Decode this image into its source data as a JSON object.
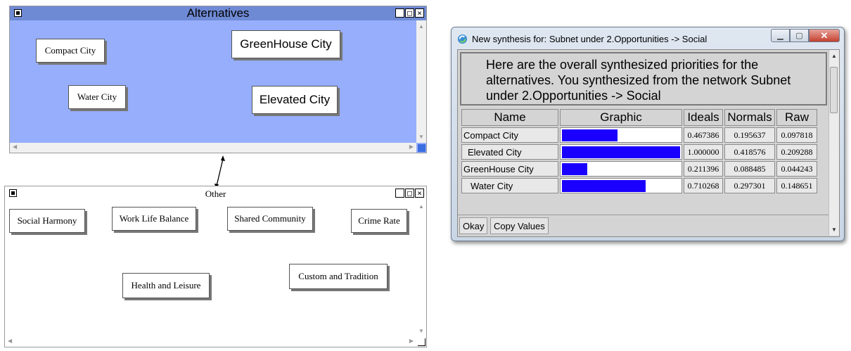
{
  "alternatives": {
    "title": "Alternatives",
    "window_controls": [
      "_",
      "□",
      "×"
    ],
    "nodes": [
      "Compact City",
      "GreenHouse City",
      "Water City",
      "Elevated City"
    ],
    "bg_color": "#96aefc",
    "title_bar_color": "#6f8ad5"
  },
  "other": {
    "title": "Other",
    "window_controls": [
      "_",
      "□",
      "×"
    ],
    "nodes": [
      "Social Harmony",
      "Work Life Balance",
      "Shared Community",
      "Crime Rate",
      "Health and Leisure",
      "Custom and Tradition"
    ]
  },
  "dialog": {
    "title": "New synthesis for: Subnet under 2.Opportunities -> Social",
    "description": "Here are the overall synthesized priorities for the alternatives.  You synthesized from the network Subnet under 2.Opportunities -> Social",
    "columns": [
      "Name",
      "Graphic",
      "Ideals",
      "Normals",
      "Raw"
    ],
    "rows": [
      {
        "name": "Compact City",
        "ideal": 0.467386,
        "ideals": "0.467386",
        "normals": "0.195637",
        "raw": "0.097818"
      },
      {
        "name": "Elevated City",
        "ideal": 1.0,
        "ideals": "1.000000",
        "normals": "0.418576",
        "raw": "0.209288"
      },
      {
        "name": "GreenHouse City",
        "ideal": 0.211396,
        "ideals": "0.211396",
        "normals": "0.088485",
        "raw": "0.044243"
      },
      {
        "name": "Water City",
        "ideal": 0.710268,
        "ideals": "0.710268",
        "normals": "0.297301",
        "raw": "0.148651"
      }
    ],
    "bar_color": "#1a00ff",
    "buttons": {
      "okay": "Okay",
      "copy": "Copy Values"
    }
  }
}
